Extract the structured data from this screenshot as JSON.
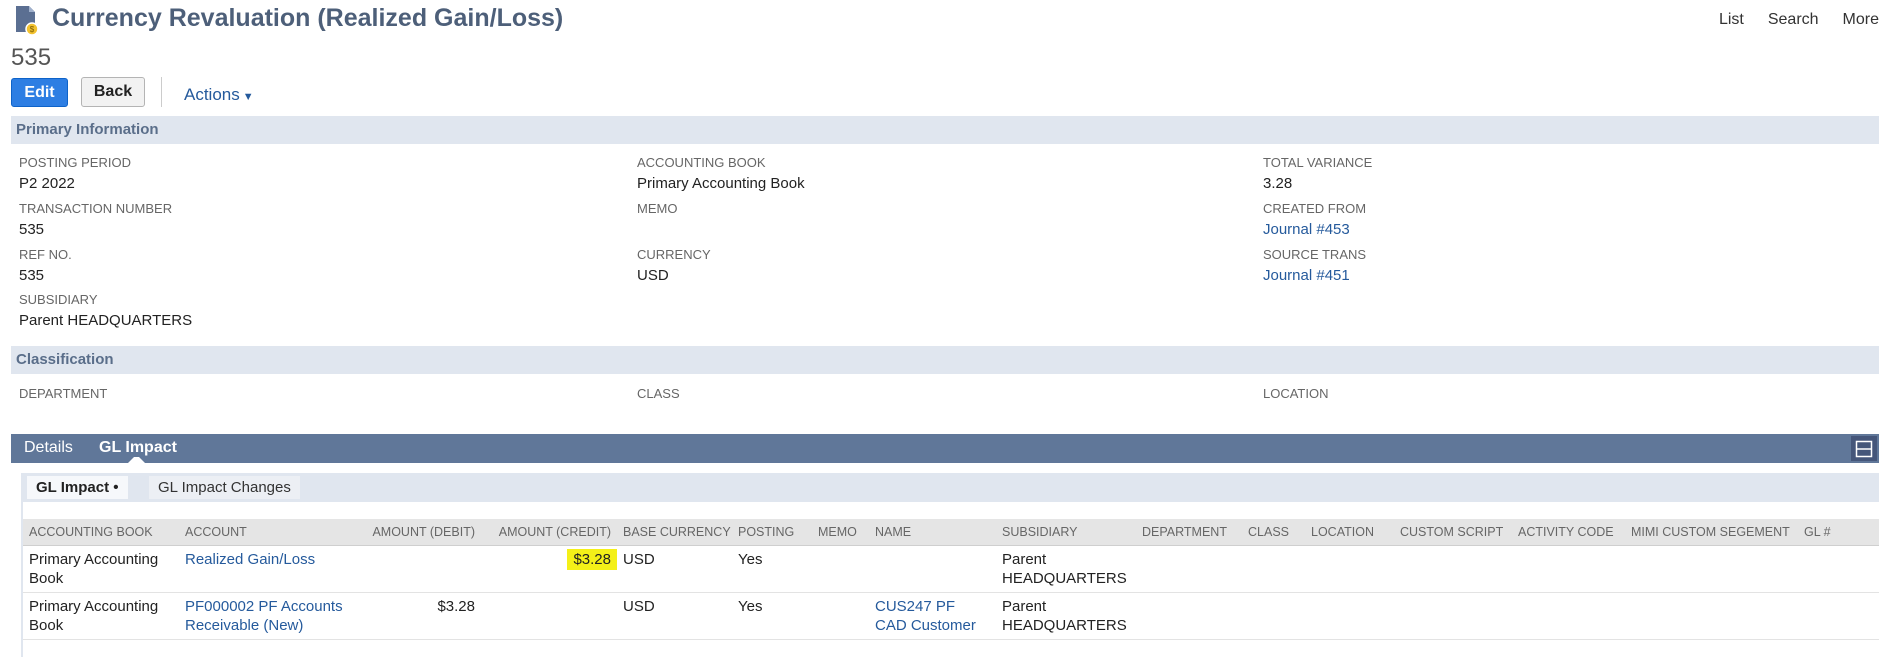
{
  "header": {
    "title": "Currency Revaluation (Realized Gain/Loss)",
    "record_number": "535",
    "links": [
      "List",
      "Search",
      "More"
    ]
  },
  "toolbar": {
    "edit_label": "Edit",
    "back_label": "Back",
    "actions_label": "Actions"
  },
  "primary": {
    "section_title": "Primary Information",
    "posting_period": {
      "label": "POSTING PERIOD",
      "value": "P2 2022"
    },
    "transaction_number": {
      "label": "TRANSACTION NUMBER",
      "value": "535"
    },
    "ref_no": {
      "label": "REF NO.",
      "value": "535"
    },
    "subsidiary": {
      "label": "SUBSIDIARY",
      "value": "Parent HEADQUARTERS"
    },
    "accounting_book": {
      "label": "ACCOUNTING BOOK",
      "value": "Primary Accounting Book"
    },
    "memo": {
      "label": "MEMO",
      "value": ""
    },
    "currency": {
      "label": "CURRENCY",
      "value": "USD"
    },
    "total_variance": {
      "label": "TOTAL VARIANCE",
      "value": "3.28"
    },
    "created_from": {
      "label": "CREATED FROM",
      "value": "Journal #453"
    },
    "source_trans": {
      "label": "SOURCE TRANS",
      "value": "Journal #451"
    }
  },
  "classification": {
    "section_title": "Classification",
    "department": {
      "label": "DEPARTMENT"
    },
    "class": {
      "label": "CLASS"
    },
    "location": {
      "label": "LOCATION"
    }
  },
  "subtabs": {
    "details": "Details",
    "gl_impact": "GL Impact"
  },
  "gl": {
    "tab_active": "GL Impact •",
    "tab_changes": "GL Impact Changes",
    "columns": [
      "ACCOUNTING BOOK",
      "ACCOUNT",
      "AMOUNT (DEBIT)",
      "AMOUNT (CREDIT)",
      "BASE CURRENCY",
      "POSTING",
      "MEMO",
      "NAME",
      "SUBSIDIARY",
      "DEPARTMENT",
      "CLASS",
      "LOCATION",
      "CUSTOM SCRIPT",
      "ACTIVITY CODE",
      "MIMI CUSTOM SEGEMENT",
      "GL #"
    ],
    "rows": [
      {
        "book": "Primary Accounting Book",
        "account": "Realized Gain/Loss",
        "debit": "",
        "credit": "$3.28",
        "base_currency": "USD",
        "posting": "Yes",
        "memo": "",
        "name": "",
        "subsidiary": "Parent HEADQUARTERS"
      },
      {
        "book": "Primary Accounting Book",
        "account": "PF000002 PF Accounts Receivable (New)",
        "debit": "$3.28",
        "credit": "",
        "base_currency": "USD",
        "posting": "Yes",
        "memo": "",
        "name": "CUS247 PF CAD Customer",
        "subsidiary": "Parent HEADQUARTERS"
      }
    ]
  },
  "colors": {
    "title": "#4d5f79",
    "edit_button": "#2d7ee3",
    "section_bar": "#e0e6ef",
    "subtab_bar": "#607799",
    "link": "#255a9c",
    "highlight": "#f4f018"
  }
}
